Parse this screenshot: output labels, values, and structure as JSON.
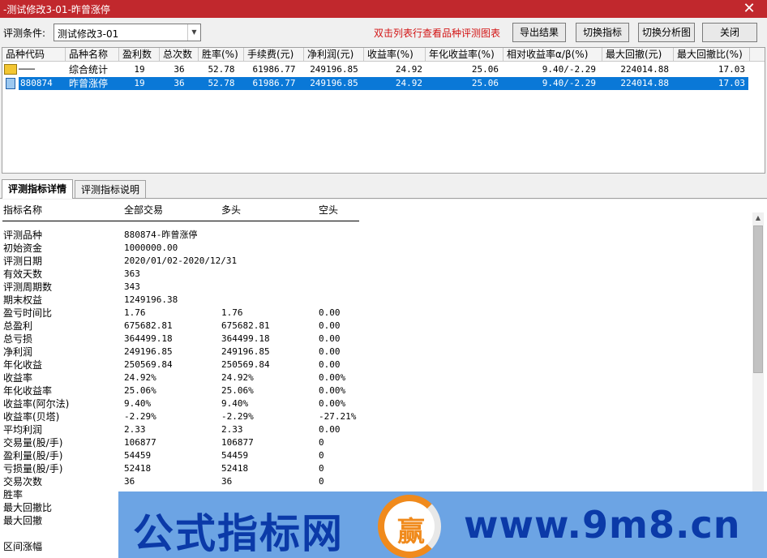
{
  "window": {
    "title": "-测试修改3-01-昨曾涨停",
    "close_glyph": "✕"
  },
  "toolbar": {
    "condition_label": "评测条件:",
    "condition_value": "测试修改3-01",
    "hint": "双击列表行查看品种评测图表",
    "buttons": {
      "export": "导出结果",
      "switch_indicator": "切换指标",
      "switch_chart": "切换分析图",
      "close": "关闭"
    }
  },
  "grid": {
    "headers": [
      "品种代码",
      "品种名称",
      "盈利数",
      "总次数",
      "胜率(%)",
      "手续费(元)",
      "净利润(元)",
      "收益率(%)",
      "年化收益率(%)",
      "相对收益率α/β(%)",
      "最大回撤(元)",
      "最大回撤比(%)"
    ],
    "rows": [
      {
        "code": "───",
        "name": "综合统计",
        "wins": "19",
        "total": "36",
        "winrate": "52.78",
        "fee": "61986.77",
        "net": "249196.85",
        "ret": "24.92",
        "annual": "25.06",
        "alphabeta": "9.40/-2.29",
        "maxdd": "224014.88",
        "maxddratio": "17.03",
        "icon": "summary-icon"
      },
      {
        "code": "880874",
        "name": "昨曾涨停",
        "wins": "19",
        "total": "36",
        "winrate": "52.78",
        "fee": "61986.77",
        "net": "249196.85",
        "ret": "24.92",
        "annual": "25.06",
        "alphabeta": "9.40/-2.29",
        "maxdd": "224014.88",
        "maxddratio": "17.03",
        "icon": "stock-icon"
      }
    ],
    "colors": {
      "selected": "#0a78d7"
    }
  },
  "tabs": [
    {
      "label": "评测指标详情",
      "active": true
    },
    {
      "label": "评测指标说明",
      "active": false
    }
  ],
  "detail": {
    "headers": {
      "name": "指标名称",
      "all": "全部交易",
      "long": "多头",
      "short": "空头"
    },
    "rows": [
      {
        "name": "评测品种",
        "all": "880874-昨曾涨停",
        "long": "",
        "short": ""
      },
      {
        "name": "初始资金",
        "all": "1000000.00",
        "long": "",
        "short": ""
      },
      {
        "name": "评测日期",
        "all": "2020/01/02-2020/12/31",
        "long": "",
        "short": ""
      },
      {
        "name": "有效天数",
        "all": "363",
        "long": "",
        "short": ""
      },
      {
        "name": "评测周期数",
        "all": "343",
        "long": "",
        "short": ""
      },
      {
        "name": "期末权益",
        "all": "1249196.38",
        "long": "",
        "short": ""
      },
      {
        "name": "盈亏时间比",
        "all": "1.76",
        "long": "1.76",
        "short": "0.00"
      },
      {
        "name": "总盈利",
        "all": "675682.81",
        "long": "675682.81",
        "short": "0.00"
      },
      {
        "name": "总亏损",
        "all": "364499.18",
        "long": "364499.18",
        "short": "0.00"
      },
      {
        "name": "净利润",
        "all": "249196.85",
        "long": "249196.85",
        "short": "0.00"
      },
      {
        "name": "年化收益",
        "all": "250569.84",
        "long": "250569.84",
        "short": "0.00"
      },
      {
        "name": "收益率",
        "all": "24.92%",
        "long": "24.92%",
        "short": "0.00%"
      },
      {
        "name": "年化收益率",
        "all": "25.06%",
        "long": "25.06%",
        "short": "0.00%"
      },
      {
        "name": "收益率(阿尔法)",
        "all": "9.40%",
        "long": "9.40%",
        "short": "0.00%"
      },
      {
        "name": "收益率(贝塔)",
        "all": "-2.29%",
        "long": "-2.29%",
        "short": "-27.21%"
      },
      {
        "name": "平均利润",
        "all": "2.33",
        "long": "2.33",
        "short": "0.00"
      },
      {
        "name": "交易量(股/手)",
        "all": "106877",
        "long": "106877",
        "short": "0"
      },
      {
        "name": "盈利量(股/手)",
        "all": "54459",
        "long": "54459",
        "short": "0"
      },
      {
        "name": "亏损量(股/手)",
        "all": "52418",
        "long": "52418",
        "short": "0"
      },
      {
        "name": "交易次数",
        "all": "36",
        "long": "36",
        "short": "0"
      },
      {
        "name": "胜率",
        "all": "",
        "long": "",
        "short": ""
      },
      {
        "name": "最大回撤比",
        "all": "",
        "long": "",
        "short": ""
      },
      {
        "name": "最大回撤",
        "all": "",
        "long": "",
        "short": ""
      },
      {
        "name": "区间涨幅",
        "all": "",
        "long": "",
        "short": ""
      }
    ]
  },
  "banner": {
    "brand": "公式指标网",
    "logo_char": "赢",
    "url": "www.9m8.cn"
  }
}
